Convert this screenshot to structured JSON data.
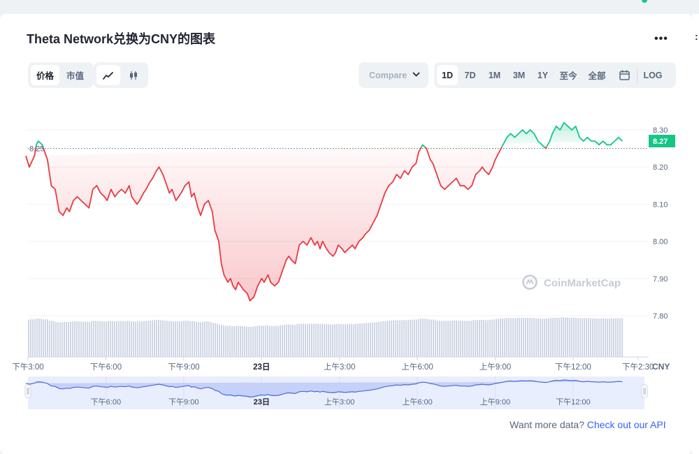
{
  "title": "Theta Network兑换为CNY的图表",
  "more_icon": "more-dots-icon",
  "edge_text": ":",
  "toggles": {
    "price": "价格",
    "market_cap": "市值",
    "line_icon": "line-chart-icon",
    "candle_icon": "candlestick-icon"
  },
  "compare": {
    "label": "Compare w",
    "icon": "chevron-down-icon"
  },
  "ranges": [
    "1D",
    "7D",
    "1M",
    "3M",
    "1Y",
    "至今",
    "全部"
  ],
  "active_range": "1D",
  "calendar_icon": "calendar-icon",
  "log_label": "LOG",
  "colors": {
    "up": "#16c784",
    "down": "#ea3943",
    "accent": "#3861fb"
  },
  "footer": {
    "text": "Want more data? ",
    "link": "Check out our API"
  },
  "chart_data": {
    "type": "line",
    "currency_label": "CNY",
    "watermark": "CoinMarketCap",
    "reference_label": "8.25",
    "current_label": "8.27",
    "reference_value": 8.25,
    "ylim": [
      7.75,
      8.37
    ],
    "yticks": [
      "8.30",
      "8.20",
      "8.10",
      "8.00",
      "7.90",
      "7.80"
    ],
    "xticks": [
      {
        "label": "下午3:00",
        "t": 0,
        "bold": false
      },
      {
        "label": "下午6:00",
        "t": 3,
        "bold": false
      },
      {
        "label": "下午9:00",
        "t": 6,
        "bold": false
      },
      {
        "label": "23日",
        "t": 9,
        "bold": true
      },
      {
        "label": "上午3:00",
        "t": 12,
        "bold": false
      },
      {
        "label": "上午6:00",
        "t": 15,
        "bold": false
      },
      {
        "label": "上午9:00",
        "t": 18,
        "bold": false
      },
      {
        "label": "下午12:00",
        "t": 21,
        "bold": false
      },
      {
        "label": "下午2:30",
        "t": 23.5,
        "bold": false
      }
    ],
    "nav_labels": [
      {
        "label": "下午6:00",
        "t": 3,
        "bold": false
      },
      {
        "label": "下午9:00",
        "t": 6,
        "bold": false
      },
      {
        "label": "23日",
        "t": 9,
        "bold": true
      },
      {
        "label": "上午3:00",
        "t": 12,
        "bold": false
      },
      {
        "label": "上午6:00",
        "t": 15,
        "bold": false
      },
      {
        "label": "上午9:00",
        "t": 18,
        "bold": false
      },
      {
        "label": "下午12:00",
        "t": 21,
        "bold": false
      }
    ],
    "x_hours": [
      -0.08,
      0.05,
      0.25,
      0.32,
      0.4,
      0.55,
      0.75,
      0.9,
      1.05,
      1.2,
      1.35,
      1.5,
      1.6,
      1.75,
      1.9,
      2.05,
      2.2,
      2.35,
      2.5,
      2.65,
      2.8,
      2.95,
      3.05,
      3.2,
      3.35,
      3.45,
      3.6,
      3.75,
      3.9,
      4.0,
      4.1,
      4.2,
      4.3,
      4.45,
      4.55,
      4.7,
      4.8,
      4.95,
      5.05,
      5.2,
      5.35,
      5.45,
      5.55,
      5.7,
      5.8,
      5.9,
      6.05,
      6.2,
      6.3,
      6.4,
      6.55,
      6.65,
      6.8,
      6.95,
      7.1,
      7.2,
      7.35,
      7.45,
      7.55,
      7.7,
      7.8,
      7.9,
      8.0,
      8.1,
      8.2,
      8.3,
      8.45,
      8.55,
      8.7,
      8.85,
      9.0,
      9.1,
      9.25,
      9.35,
      9.5,
      9.65,
      9.75,
      9.85,
      9.95,
      10.05,
      10.15,
      10.3,
      10.45,
      10.6,
      10.75,
      10.9,
      11.05,
      11.15,
      11.25,
      11.35,
      11.5,
      11.6,
      11.75,
      11.85,
      11.95,
      12.1,
      12.2,
      12.35,
      12.5,
      12.6,
      12.75,
      12.9,
      13.0,
      13.15,
      13.3,
      13.45,
      13.6,
      13.75,
      13.9,
      14.05,
      14.2,
      14.35,
      14.5,
      14.65,
      14.8,
      14.95,
      15.05,
      15.2,
      15.35,
      15.5,
      15.6,
      15.75,
      15.9,
      16.05,
      16.2,
      16.35,
      16.5,
      16.65,
      16.8,
      16.95,
      17.1,
      17.25,
      17.4,
      17.5,
      17.6,
      17.75,
      17.9,
      18.0,
      18.15,
      18.3,
      18.45,
      18.6,
      18.75,
      18.9,
      19.05,
      19.2,
      19.35,
      19.5,
      19.65,
      19.8,
      19.95,
      20.1,
      20.2,
      20.35,
      20.5,
      20.65,
      20.8,
      20.95,
      21.1,
      21.25,
      21.4,
      21.55,
      21.7,
      21.85,
      22.0,
      22.15,
      22.3,
      22.45,
      22.6,
      22.75,
      22.9,
      23.05,
      23.2,
      23.35,
      23.5,
      23.6,
      23.75
    ],
    "values": [
      8.23,
      8.2,
      8.23,
      8.26,
      8.27,
      8.26,
      8.22,
      8.15,
      8.14,
      8.08,
      8.07,
      8.09,
      8.08,
      8.11,
      8.12,
      8.11,
      8.1,
      8.09,
      8.14,
      8.15,
      8.13,
      8.12,
      8.11,
      8.14,
      8.12,
      8.13,
      8.14,
      8.13,
      8.15,
      8.12,
      8.11,
      8.1,
      8.11,
      8.13,
      8.14,
      8.16,
      8.17,
      8.19,
      8.2,
      8.18,
      8.15,
      8.13,
      8.14,
      8.11,
      8.12,
      8.13,
      8.15,
      8.16,
      8.12,
      8.13,
      8.09,
      8.07,
      8.1,
      8.11,
      8.08,
      8.03,
      8.0,
      7.94,
      7.91,
      7.89,
      7.9,
      7.88,
      7.87,
      7.89,
      7.88,
      7.87,
      7.86,
      7.84,
      7.85,
      7.88,
      7.9,
      7.89,
      7.91,
      7.89,
      7.88,
      7.89,
      7.91,
      7.93,
      7.95,
      7.96,
      7.95,
      7.94,
      7.99,
      8.0,
      7.99,
      8.01,
      7.99,
      8.0,
      7.98,
      8.0,
      7.98,
      7.97,
      7.96,
      7.97,
      7.99,
      7.98,
      7.97,
      7.98,
      7.99,
      7.98,
      8.0,
      8.01,
      8.02,
      8.03,
      8.05,
      8.07,
      8.1,
      8.13,
      8.15,
      8.16,
      8.18,
      8.17,
      8.19,
      8.18,
      8.2,
      8.21,
      8.24,
      8.26,
      8.25,
      8.22,
      8.21,
      8.18,
      8.15,
      8.14,
      8.15,
      8.16,
      8.17,
      8.15,
      8.15,
      8.14,
      8.15,
      8.18,
      8.19,
      8.2,
      8.19,
      8.18,
      8.2,
      8.22,
      8.24,
      8.26,
      8.28,
      8.29,
      8.28,
      8.29,
      8.3,
      8.29,
      8.3,
      8.29,
      8.27,
      8.26,
      8.25,
      8.27,
      8.29,
      8.31,
      8.3,
      8.32,
      8.31,
      8.3,
      8.31,
      8.28,
      8.27,
      8.28,
      8.27,
      8.27,
      8.26,
      8.27,
      8.26,
      8.26,
      8.27,
      8.28,
      8.27
    ]
  }
}
